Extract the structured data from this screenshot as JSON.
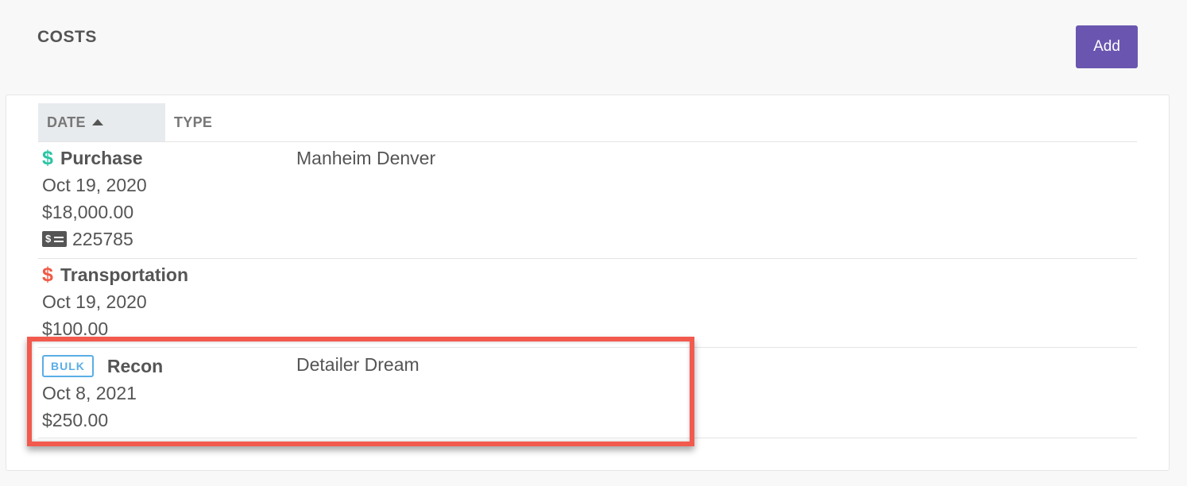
{
  "header": {
    "title": "COSTS",
    "add_label": "Add"
  },
  "table": {
    "columns": {
      "date": "DATE",
      "type": "TYPE"
    },
    "sort": {
      "column": "DATE",
      "direction": "ascending"
    },
    "rows": [
      {
        "kind": "Purchase",
        "kind_icon": "dollar-icon",
        "kind_color": "#2dc4a5",
        "date": "Oct 19, 2020",
        "amount": "$18,000.00",
        "check_number": "225785",
        "check_icon": "check-payment-icon",
        "vendor": "Manheim Denver"
      },
      {
        "kind": "Transportation",
        "kind_icon": "dollar-icon",
        "kind_color": "#f05a47",
        "date": "Oct 19, 2020",
        "amount": "$100.00",
        "vendor": ""
      },
      {
        "badge": "BULK",
        "kind": "Recon",
        "date": "Oct 8, 2021",
        "amount": "$250.00",
        "vendor": "Detailer Dream"
      }
    ]
  },
  "colors": {
    "accent": "#6a56b0",
    "highlight": "#f25a4d",
    "badge": "#5aaee6",
    "header_bg": "#e8ebee"
  }
}
